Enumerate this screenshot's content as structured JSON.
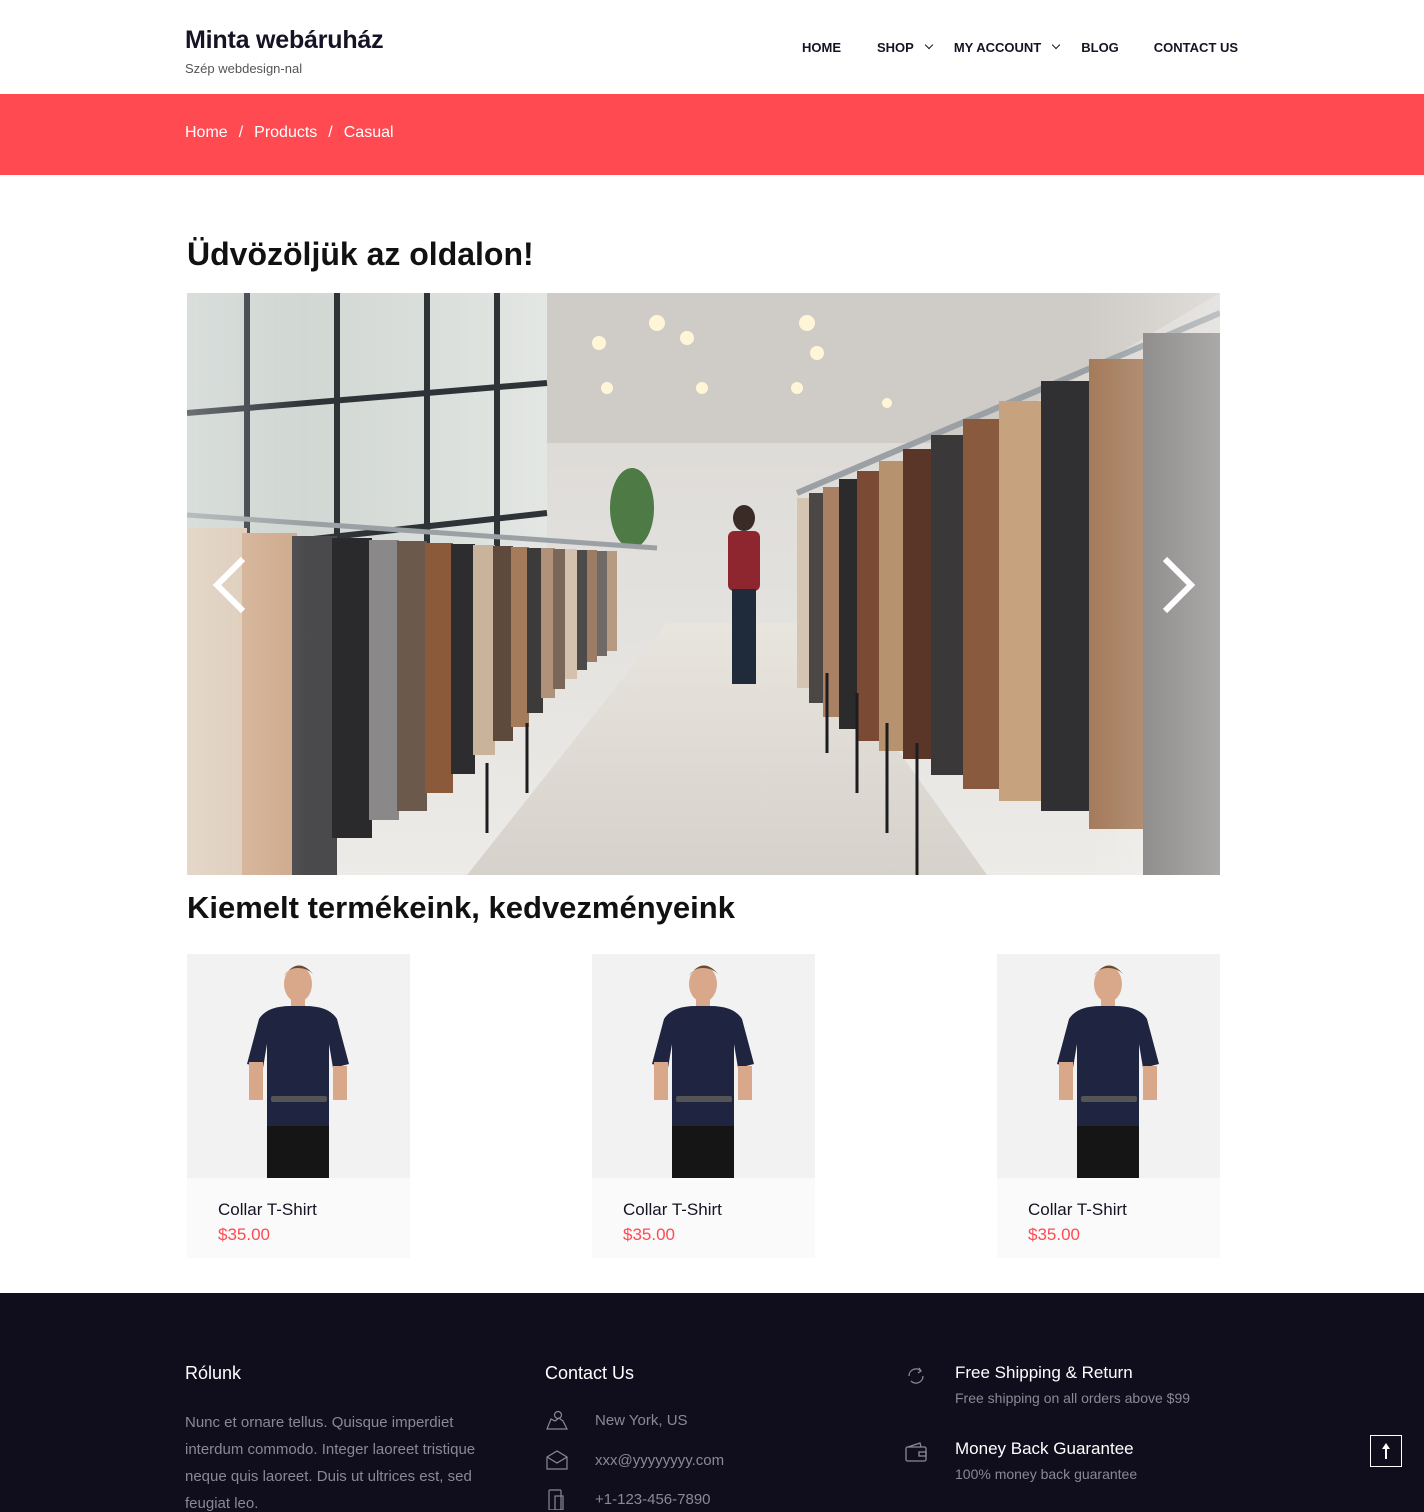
{
  "brand": {
    "title": "Minta webáruház",
    "tagline": "Szép webdesign-nal"
  },
  "nav": {
    "items": [
      {
        "label": "HOME"
      },
      {
        "label": "SHOP"
      },
      {
        "label": "MY ACCOUNT"
      },
      {
        "label": "BLOG"
      },
      {
        "label": "CONTACT US"
      }
    ]
  },
  "breadcrumb": {
    "home": "Home",
    "products": "Products",
    "current": "Casual",
    "separator": "/"
  },
  "main": {
    "welcome_title": "Üdvözöljük az oldalon!",
    "featured_title": "Kiemelt termékeink, kedvezményeink"
  },
  "products": [
    {
      "name": "Collar T-Shirt",
      "price": "$35.00"
    },
    {
      "name": "Collar T-Shirt",
      "price": "$35.00"
    },
    {
      "name": "Collar T-Shirt",
      "price": "$35.00"
    }
  ],
  "footer": {
    "about_title": "Rólunk",
    "about_text": "Nunc et ornare tellus. Quisque imperdiet interdum commodo. Integer laoreet tristique neque quis laoreet. Duis ut ultrices est, sed feugiat leo.",
    "contact_title": "Contact Us",
    "address": "New York, US",
    "email": "xxx@yyyyyyyy.com",
    "phone": "+1-123-456-7890",
    "perks": [
      {
        "title": "Free Shipping & Return",
        "subtitle": "Free shipping on all orders above $99"
      },
      {
        "title": "Money Back Guarantee",
        "subtitle": "100% money back guarantee"
      }
    ]
  },
  "colors": {
    "accent": "#ff4a52",
    "footer_bg": "#100d1d",
    "text_dark": "#151324"
  }
}
